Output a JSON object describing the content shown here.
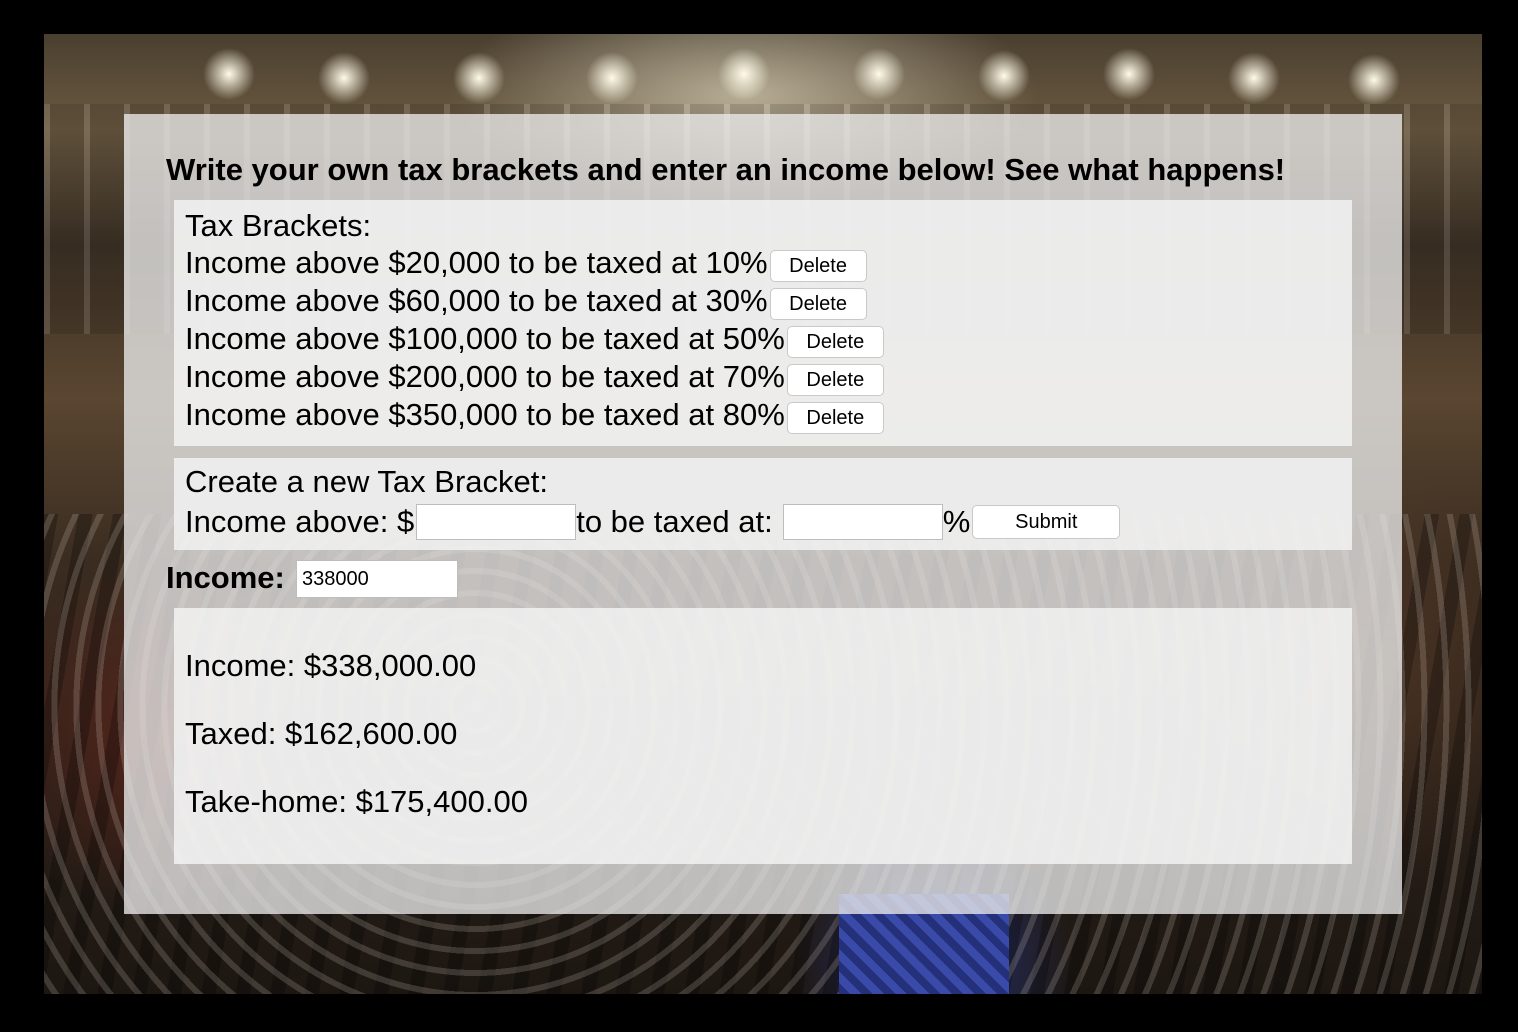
{
  "headline": "Write your own tax brackets and enter an income below! See what happens!",
  "brackets": {
    "title": "Tax Brackets:",
    "items": [
      {
        "text": "Income above $20,000 to be taxed at 10%",
        "delete_label": "Delete"
      },
      {
        "text": "Income above $60,000 to be taxed at 30%",
        "delete_label": "Delete"
      },
      {
        "text": "Income above $100,000 to be taxed at 50%",
        "delete_label": "Delete"
      },
      {
        "text": "Income above $200,000 to be taxed at 70%",
        "delete_label": "Delete"
      },
      {
        "text": "Income above $350,000 to be taxed at 80%",
        "delete_label": "Delete"
      }
    ]
  },
  "create": {
    "title": "Create a new Tax Bracket:",
    "income_prefix": "Income above: $",
    "rate_prefix": "to be taxed at:",
    "percent_sign": "%",
    "amount_value": "",
    "rate_value": "",
    "submit_label": "Submit"
  },
  "income": {
    "label": "Income:",
    "value": "338000"
  },
  "results": {
    "income": "Income: $338,000.00",
    "taxed": "Taxed: $162,600.00",
    "take_home": "Take-home: $175,400.00"
  }
}
